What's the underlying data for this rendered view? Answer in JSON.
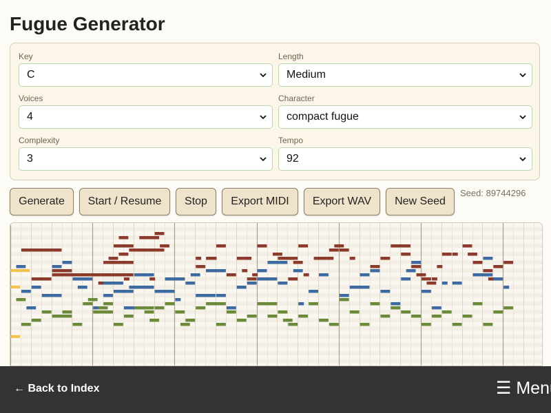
{
  "title": "Fugue Generator",
  "controls": {
    "key": {
      "label": "Key",
      "value": "C"
    },
    "length": {
      "label": "Length",
      "value": "Medium"
    },
    "voices": {
      "label": "Voices",
      "value": "4"
    },
    "character": {
      "label": "Character",
      "value": "compact fugue"
    },
    "complexity": {
      "label": "Complexity",
      "value": "3"
    },
    "tempo": {
      "label": "Tempo",
      "value": "92"
    }
  },
  "actions": {
    "generate": "Generate",
    "start_resume": "Start / Resume",
    "stop": "Stop",
    "export_midi": "Export MIDI",
    "export_wav": "Export WAV",
    "new_seed": "New Seed"
  },
  "seed_text": "Seed: 89744296",
  "footer": {
    "back": "← Back to Index",
    "menu": "☰ Menu"
  },
  "colors": {
    "voice_1": "#8b3a2b",
    "voice_2": "#3d6aa0",
    "voice_3": "#6b8a3a",
    "playhead": "#f2c14e",
    "panel_bg": "#fbf6e8",
    "button_bg": "#f0e3cc"
  },
  "piano_roll": {
    "voices": [
      {
        "name": "voice_1",
        "notes": [
          [
            1,
            4,
            6
          ],
          [
            2,
            2,
            13
          ],
          [
            4,
            2,
            11
          ],
          [
            4,
            4,
            12
          ],
          [
            6,
            6,
            12
          ],
          [
            9,
            3,
            9
          ],
          [
            9.5,
            1,
            8
          ],
          [
            10.5,
            1,
            7
          ],
          [
            8.5,
            2,
            14
          ],
          [
            10,
            2,
            5
          ],
          [
            10.5,
            1,
            3
          ],
          [
            11,
            0.5,
            13
          ],
          [
            11.5,
            3,
            6
          ],
          [
            13.5,
            0.5,
            13
          ],
          [
            12,
            2,
            6
          ],
          [
            14,
            1,
            2
          ],
          [
            12.5,
            2,
            3
          ],
          [
            13,
            2,
            6
          ],
          [
            14.5,
            1,
            5
          ],
          [
            16,
            1,
            13
          ],
          [
            18,
            0.5,
            8
          ],
          [
            19,
            0.5,
            11
          ],
          [
            18,
            1,
            10
          ],
          [
            19,
            1,
            8
          ],
          [
            19.5,
            0.5,
            8
          ],
          [
            20,
            1,
            5
          ],
          [
            21,
            0.5,
            12
          ],
          [
            21,
            1,
            12
          ],
          [
            23,
            1,
            13
          ],
          [
            22,
            1.5,
            8
          ],
          [
            24,
            1,
            5
          ],
          [
            25.5,
            1,
            7
          ],
          [
            22.5,
            0.5,
            11
          ],
          [
            23.5,
            0.5,
            12
          ],
          [
            25,
            0.5,
            9
          ],
          [
            26,
            2,
            8
          ],
          [
            27,
            1,
            13
          ],
          [
            28,
            1,
            5
          ],
          [
            27.5,
            1,
            9
          ],
          [
            28.5,
            0.5,
            12
          ],
          [
            29.5,
            2,
            8
          ],
          [
            31,
            1,
            6
          ],
          [
            31.5,
            1,
            5
          ],
          [
            32,
            1,
            6
          ],
          [
            33,
            0.5,
            8
          ],
          [
            34,
            1,
            12
          ],
          [
            35,
            1,
            10
          ],
          [
            36,
            1,
            8
          ],
          [
            37,
            2,
            5
          ],
          [
            38,
            1,
            7
          ],
          [
            39,
            1,
            10
          ],
          [
            39.5,
            1,
            12
          ],
          [
            40,
            1,
            13
          ],
          [
            40.5,
            1,
            14
          ],
          [
            41,
            0.5,
            13
          ],
          [
            41.5,
            0.5,
            10
          ],
          [
            42,
            1,
            7
          ],
          [
            43,
            0.5,
            7
          ],
          [
            44,
            1,
            5
          ],
          [
            44.5,
            1,
            7
          ],
          [
            45,
            1,
            9
          ],
          [
            46,
            1,
            11
          ],
          [
            46.5,
            0.5,
            13
          ],
          [
            47,
            1,
            10
          ],
          [
            48,
            1,
            9
          ]
        ]
      },
      {
        "name": "voice_2",
        "notes": [
          [
            0.5,
            1,
            10
          ],
          [
            1,
            1,
            16
          ],
          [
            1.5,
            1,
            20
          ],
          [
            2,
            1,
            15
          ],
          [
            3,
            2,
            17
          ],
          [
            4,
            1,
            10
          ],
          [
            5,
            1,
            9
          ],
          [
            6,
            2,
            13
          ],
          [
            6.5,
            1,
            15
          ],
          [
            8,
            1,
            20
          ],
          [
            9,
            1,
            17
          ],
          [
            9,
            2,
            14
          ],
          [
            10,
            2,
            16
          ],
          [
            11,
            2,
            20
          ],
          [
            11.5,
            2,
            15
          ],
          [
            12,
            2,
            12
          ],
          [
            13,
            1,
            15
          ],
          [
            14,
            2,
            16
          ],
          [
            15,
            2,
            13
          ],
          [
            16,
            0.5,
            18
          ],
          [
            17,
            1,
            14
          ],
          [
            17.5,
            1,
            12
          ],
          [
            18,
            2,
            17
          ],
          [
            19,
            2,
            11
          ],
          [
            20,
            1,
            17
          ],
          [
            21,
            1,
            20
          ],
          [
            22,
            1,
            15
          ],
          [
            23,
            1,
            14
          ],
          [
            24,
            1,
            11
          ],
          [
            24,
            2,
            13
          ],
          [
            25,
            2,
            9
          ],
          [
            26,
            1,
            14
          ],
          [
            27.5,
            1,
            11
          ],
          [
            28,
            0.5,
            19
          ],
          [
            29,
            1,
            16
          ],
          [
            30,
            1,
            12
          ],
          [
            32,
            1,
            17
          ],
          [
            33,
            2,
            15
          ],
          [
            34,
            1,
            12
          ],
          [
            35,
            1,
            11
          ],
          [
            36,
            1,
            16
          ],
          [
            37,
            1,
            19
          ],
          [
            38,
            1,
            13
          ],
          [
            38.5,
            1,
            11
          ],
          [
            39,
            1,
            9
          ],
          [
            40,
            1,
            16
          ],
          [
            41,
            1,
            20
          ],
          [
            42,
            0.5,
            14
          ],
          [
            43,
            1,
            14
          ],
          [
            45,
            2,
            12
          ],
          [
            46,
            1,
            8
          ],
          [
            47,
            1,
            13
          ],
          [
            48,
            0.5,
            15
          ]
        ]
      },
      {
        "name": "voice_3",
        "notes": [
          [
            0.5,
            1,
            18
          ],
          [
            1,
            1,
            24
          ],
          [
            2,
            1,
            23
          ],
          [
            3,
            1,
            21
          ],
          [
            4,
            2,
            22
          ],
          [
            5,
            1,
            21
          ],
          [
            6,
            1,
            24
          ],
          [
            7,
            1,
            19
          ],
          [
            7.5,
            1,
            18
          ],
          [
            8,
            2,
            21
          ],
          [
            8.5,
            1,
            20
          ],
          [
            9,
            1,
            19
          ],
          [
            10,
            1,
            24
          ],
          [
            11,
            1,
            22
          ],
          [
            12,
            2,
            20
          ],
          [
            13,
            1,
            21
          ],
          [
            13.5,
            1,
            23
          ],
          [
            14,
            1,
            20
          ],
          [
            15,
            1,
            19
          ],
          [
            16,
            1,
            21
          ],
          [
            16.5,
            1,
            24
          ],
          [
            17,
            1,
            23
          ],
          [
            18,
            1,
            20
          ],
          [
            19,
            2,
            19
          ],
          [
            20,
            1,
            24
          ],
          [
            21,
            1,
            21
          ],
          [
            22,
            1,
            23
          ],
          [
            23,
            1,
            22
          ],
          [
            24,
            2,
            19
          ],
          [
            25,
            1,
            22
          ],
          [
            26,
            1,
            21
          ],
          [
            26.5,
            1,
            23
          ],
          [
            27,
            1,
            24
          ],
          [
            28,
            1,
            22
          ],
          [
            29,
            1,
            19
          ],
          [
            30,
            1,
            23
          ],
          [
            31,
            1,
            24
          ],
          [
            32,
            1,
            18
          ],
          [
            33,
            1,
            21
          ],
          [
            34,
            1,
            24
          ],
          [
            35,
            1,
            19
          ],
          [
            36,
            1,
            22
          ],
          [
            37,
            1,
            20
          ],
          [
            38,
            1,
            21
          ],
          [
            39,
            1,
            22
          ],
          [
            40,
            1,
            24
          ],
          [
            41,
            1,
            22
          ],
          [
            42,
            1,
            21
          ],
          [
            43,
            1,
            24
          ],
          [
            44,
            1,
            22
          ],
          [
            45,
            1,
            19
          ],
          [
            46,
            1,
            24
          ],
          [
            47,
            1,
            21
          ],
          [
            48,
            1,
            20
          ]
        ]
      }
    ]
  }
}
